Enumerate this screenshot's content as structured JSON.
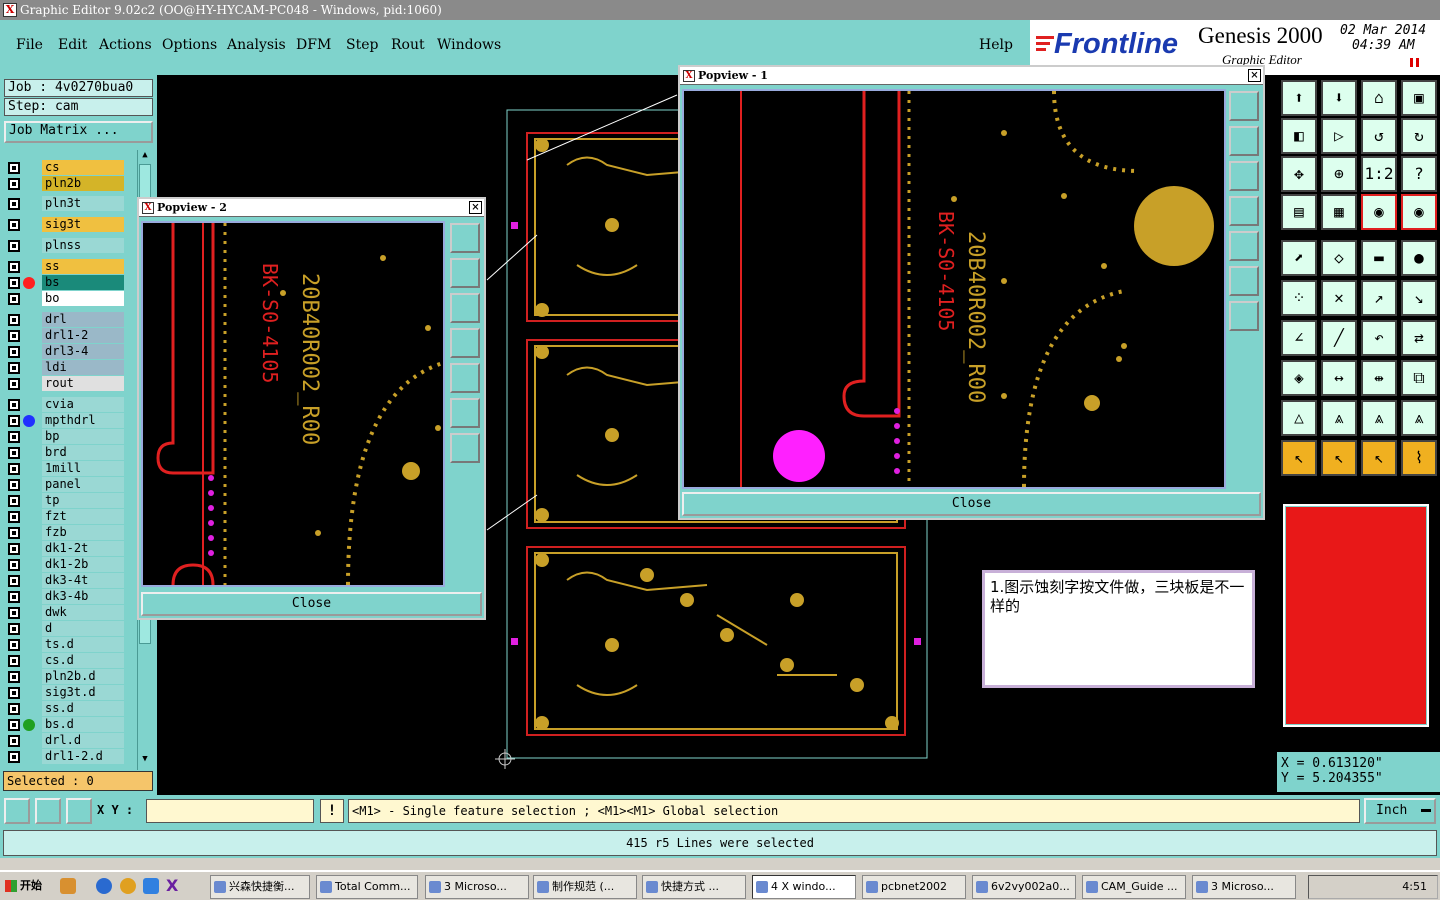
{
  "window": {
    "title": "Graphic Editor 9.02c2  (OO@HY-HYCAM-PC048 - Windows, pid:1060)"
  },
  "menu": [
    "File",
    "Edit",
    "Actions",
    "Options",
    "Analysis",
    "DFM",
    "Step",
    "Rout",
    "Windows",
    "Help"
  ],
  "brand": {
    "logo": "Frontline",
    "product": "Genesis 2000",
    "subtitle": "Graphic Editor",
    "date": "02 Mar 2014",
    "time": "04:39 AM"
  },
  "job": {
    "job_label": "Job  :  4v0270bua0",
    "step_label": "Step:  cam",
    "matrix_button": "Job Matrix ..."
  },
  "layers": [
    {
      "name": "cs",
      "color": "#f0c040",
      "dot": ""
    },
    {
      "name": "pln2b",
      "color": "#d4b428",
      "dot": ""
    },
    {
      "name": "pln3t",
      "color": "#9ad8d4",
      "dot": ""
    },
    {
      "name": "sig3t",
      "color": "#f0c040",
      "dot": ""
    },
    {
      "name": "plnss",
      "color": "#9ad8d4",
      "dot": ""
    },
    {
      "name": "ss",
      "color": "#f0c040",
      "dot": ""
    },
    {
      "name": "bs",
      "color": "#1a8a7a",
      "dot": "#ff2020"
    },
    {
      "name": "bo",
      "color": "#ffffff",
      "dot": ""
    },
    {
      "name": "drl",
      "color": "#9ab8c8",
      "dot": ""
    },
    {
      "name": "drl1-2",
      "color": "#9ab8c8",
      "dot": ""
    },
    {
      "name": "drl3-4",
      "color": "#9ab8c8",
      "dot": ""
    },
    {
      "name": "ldi",
      "color": "#9ab8c8",
      "dot": ""
    },
    {
      "name": "rout",
      "color": "#e0e0e0",
      "dot": ""
    },
    {
      "name": "cvia",
      "color": "#9ad8d4",
      "dot": ""
    },
    {
      "name": "mpthdrl",
      "color": "#9ad8d4",
      "dot": "#2030ff"
    },
    {
      "name": "bp",
      "color": "#9ad8d4",
      "dot": ""
    },
    {
      "name": "brd",
      "color": "#9ad8d4",
      "dot": ""
    },
    {
      "name": "1mill",
      "color": "#9ad8d4",
      "dot": ""
    },
    {
      "name": "panel",
      "color": "#9ad8d4",
      "dot": ""
    },
    {
      "name": "tp",
      "color": "#9ad8d4",
      "dot": ""
    },
    {
      "name": "fzt",
      "color": "#9ad8d4",
      "dot": ""
    },
    {
      "name": "fzb",
      "color": "#9ad8d4",
      "dot": ""
    },
    {
      "name": "dk1-2t",
      "color": "#9ad8d4",
      "dot": ""
    },
    {
      "name": "dk1-2b",
      "color": "#9ad8d4",
      "dot": ""
    },
    {
      "name": "dk3-4t",
      "color": "#9ad8d4",
      "dot": ""
    },
    {
      "name": "dk3-4b",
      "color": "#9ad8d4",
      "dot": ""
    },
    {
      "name": "dwk",
      "color": "#9ad8d4",
      "dot": ""
    },
    {
      "name": "d",
      "color": "#9ad8d4",
      "dot": ""
    },
    {
      "name": "ts.d",
      "color": "#9ad8d4",
      "dot": ""
    },
    {
      "name": "cs.d",
      "color": "#9ad8d4",
      "dot": ""
    },
    {
      "name": "pln2b.d",
      "color": "#9ad8d4",
      "dot": ""
    },
    {
      "name": "sig3t.d",
      "color": "#9ad8d4",
      "dot": ""
    },
    {
      "name": "ss.d",
      "color": "#9ad8d4",
      "dot": ""
    },
    {
      "name": "bs.d",
      "color": "#9ad8d4",
      "dot": "#20a020"
    },
    {
      "name": "drl.d",
      "color": "#9ad8d4",
      "dot": ""
    },
    {
      "name": "drl1-2.d",
      "color": "#9ad8d4",
      "dot": ""
    }
  ],
  "selected": "Selected : 0",
  "popview1": {
    "title": "Popview - 1",
    "close": "Close",
    "silk_text_1": "BK-S0-4105",
    "silk_text_2": "20B40R002_R00"
  },
  "popview2": {
    "title": "Popview - 2",
    "close": "Close",
    "silk_text_1": "BK-S0-4105",
    "silk_text_2": "20B40R002_R00"
  },
  "note": "1.图示蚀刻字按文件做，三块板是不一样的",
  "coords": {
    "x": "X = 0.613120\"",
    "y": "Y = 5.204355\""
  },
  "status": {
    "xy_label": "X Y :",
    "xy_value": "",
    "hint": "<M1> - Single feature selection ; <M1><M1> Global selection",
    "units": "Inch"
  },
  "message": "415 r5 Lines were selected",
  "taskbar": {
    "start": "开始",
    "items": [
      "兴森快捷衡...",
      "Total Comm...",
      "3 Microso...",
      "制作规范 (...",
      "快捷方式 ...",
      "4 X windo...",
      "pcbnet2002",
      "6v2vy002a0...",
      "CAM_Guide ...",
      "3 Microso..."
    ],
    "clock": "4:51"
  }
}
